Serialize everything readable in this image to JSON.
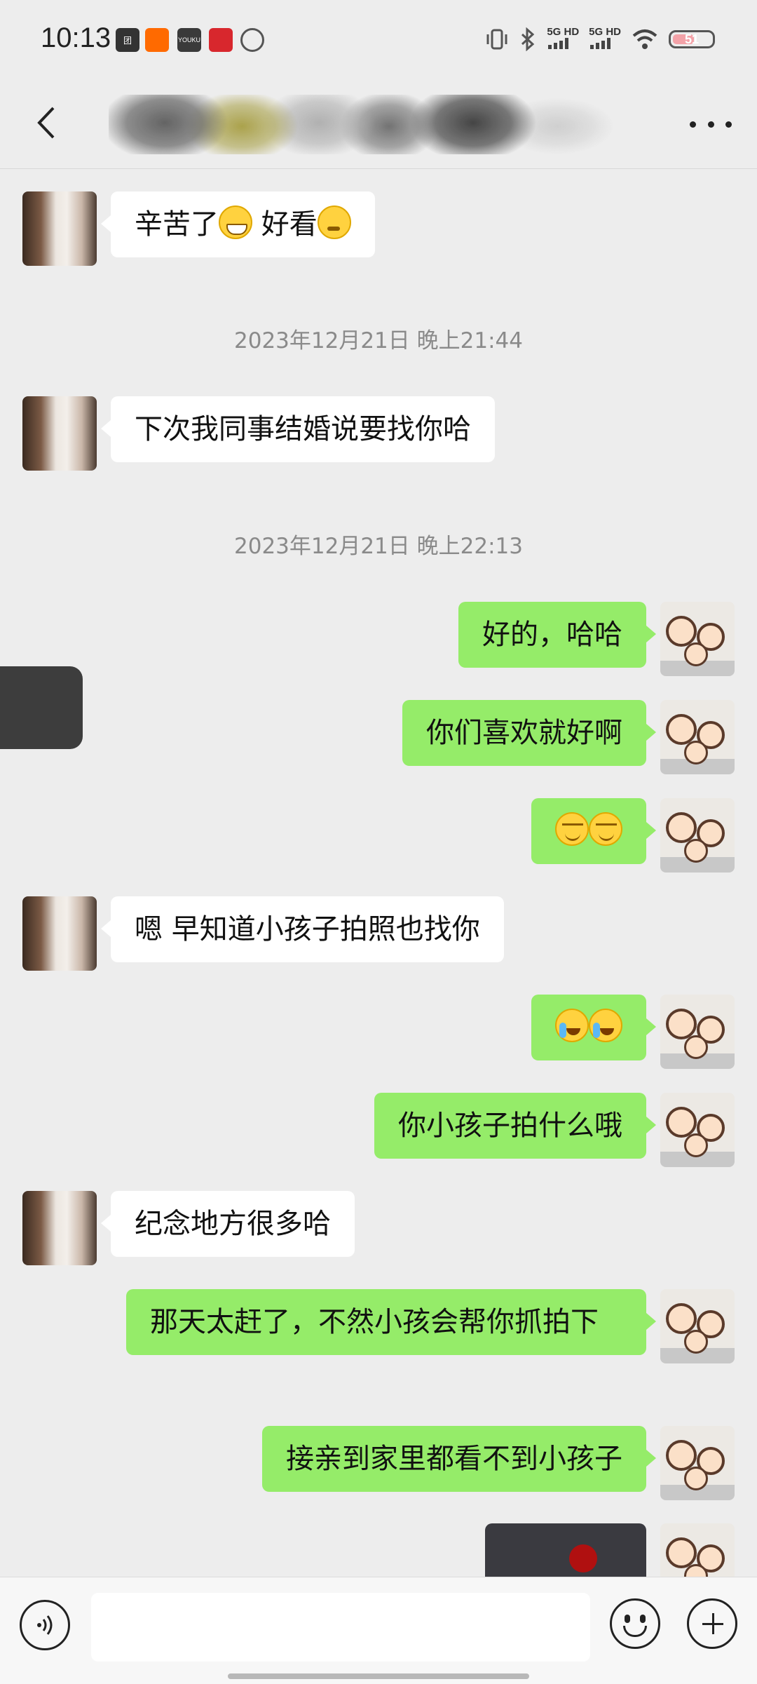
{
  "status_bar": {
    "time": "10:13",
    "apps": [
      {
        "name": "meituan-icon",
        "label": "团",
        "color": "#333333"
      },
      {
        "name": "taobao-icon",
        "label": "",
        "color": "#ff6a00"
      },
      {
        "name": "youku-icon",
        "label": "YOUKU",
        "color": "#3a3a3a"
      },
      {
        "name": "app-red-icon",
        "label": "",
        "color": "#d8272d"
      },
      {
        "name": "app-circle-icon",
        "label": "",
        "color": "#555555"
      }
    ],
    "network_1": "5G HD",
    "network_2": "5G HD",
    "battery": "51"
  },
  "header": {
    "title": ""
  },
  "messages": [
    {
      "side": "left",
      "avatar": "bride",
      "text": "辛苦了",
      "emoji_1": "grin-emoji",
      "text_2": "好看",
      "emoji_2": "thinking-emoji"
    },
    {
      "timestamp": "2023年12月21日 晚上21:44"
    },
    {
      "side": "left",
      "avatar": "bride",
      "text": "下次我同事结婚说要找你哈"
    },
    {
      "timestamp": "2023年12月21日 晚上22:13"
    },
    {
      "side": "right",
      "avatar": "family",
      "text": "好的，哈哈"
    },
    {
      "side": "right",
      "avatar": "family",
      "text": "你们喜欢就好啊"
    },
    {
      "side": "right",
      "avatar": "family",
      "emoji": "smirk-emoji",
      "count": 2
    },
    {
      "side": "left",
      "avatar": "bride",
      "text": "嗯 早知道小孩子拍照也找你"
    },
    {
      "side": "right",
      "avatar": "family",
      "emoji": "laugh-cry-emoji",
      "count": 2
    },
    {
      "side": "right",
      "avatar": "family",
      "text": "你小孩子拍什么哦"
    },
    {
      "side": "left",
      "avatar": "bride",
      "text": "纪念地方很多哈"
    },
    {
      "side": "right",
      "avatar": "family",
      "text": "那天太赶了，不然小孩会帮你抓拍下"
    },
    {
      "side": "right",
      "avatar": "family",
      "text": "接亲到家里都看不到小孩子"
    },
    {
      "side": "right",
      "avatar": "family",
      "image": "photo-thumbnail"
    }
  ],
  "bottom_bar": {
    "input_value": "",
    "input_placeholder": ""
  },
  "colors": {
    "background": "#ededed",
    "sent_bubble": "#95ec69",
    "received_bubble": "#ffffff",
    "timestamp": "#8a8a8a"
  }
}
